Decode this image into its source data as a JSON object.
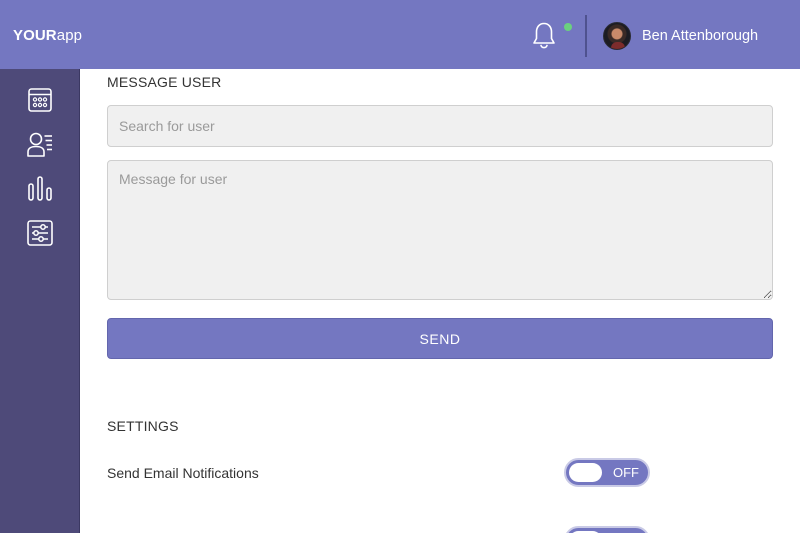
{
  "header": {
    "logo_bold": "YOUR",
    "logo_light": "app",
    "notification_icon": "bell-icon",
    "notification_dot_color": "#6bd17f",
    "user_name": "Ben Attenborough"
  },
  "sidebar": {
    "items": [
      {
        "icon": "calendar-icon"
      },
      {
        "icon": "user-list-icon"
      },
      {
        "icon": "bar-chart-icon"
      },
      {
        "icon": "sliders-icon"
      }
    ]
  },
  "message_user": {
    "title": "MESSAGE USER",
    "search_placeholder": "Search for user",
    "message_placeholder": "Message for user",
    "send_label": "SEND"
  },
  "settings": {
    "title": "SETTINGS",
    "items": [
      {
        "label": "Send Email Notifications",
        "state": "OFF"
      },
      {
        "label": "",
        "state": ""
      }
    ]
  },
  "colors": {
    "accent": "#7477c1",
    "sidebar": "#4e4a79"
  }
}
